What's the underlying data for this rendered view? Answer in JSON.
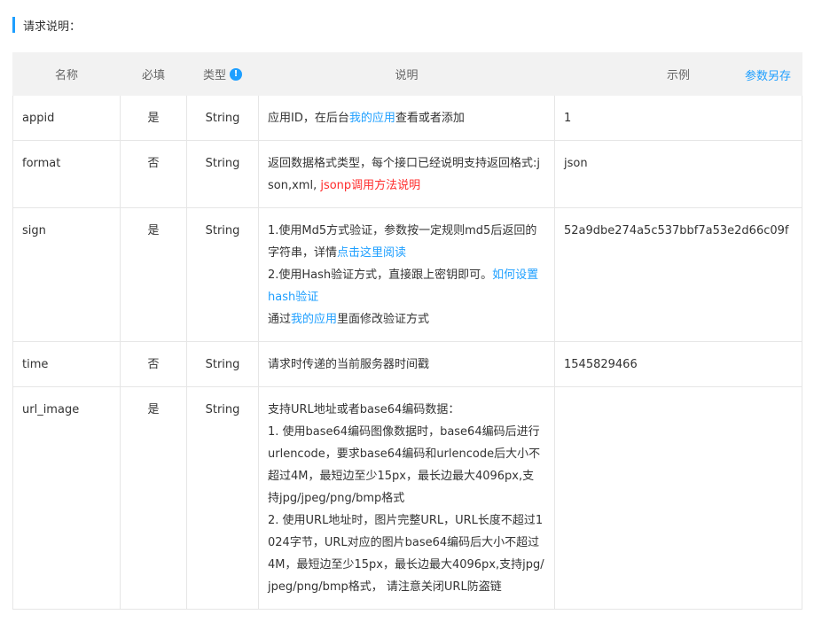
{
  "section": {
    "title": "请求说明："
  },
  "table": {
    "headers": {
      "name": "名称",
      "required": "必填",
      "type": "类型",
      "type_info_icon": "!",
      "desc": "说明",
      "example": "示例",
      "save_params": "参数另存"
    },
    "rows": [
      {
        "name": "appid",
        "required": "是",
        "type": "String",
        "desc": {
          "p1": "应用ID，在后台",
          "link1": "我的应用",
          "p2": "查看或者添加"
        },
        "example": "1"
      },
      {
        "name": "format",
        "required": "否",
        "type": "String",
        "desc": {
          "p1": "返回数据格式类型，每个接口已经说明支持返回格式:json,xml, ",
          "link1": "jsonp调用方法说明"
        },
        "example": "json"
      },
      {
        "name": "sign",
        "required": "是",
        "type": "String",
        "desc": {
          "p1": "1.使用Md5方式验证，参数按一定规则md5后返回的字符串，详情",
          "link1": "点击这里阅读",
          "p2": "2.使用Hash验证方式，直接跟上密钥即可。",
          "link2": "如何设置hash验证",
          "p3": "通过",
          "link3": "我的应用",
          "p4": "里面修改验证方式"
        },
        "example": "52a9dbe274a5c537bbf7a53e2d66c09f"
      },
      {
        "name": "time",
        "required": "否",
        "type": "String",
        "desc": {
          "p1": "请求时传递的当前服务器时间戳"
        },
        "example": "1545829466"
      },
      {
        "name": "url_image",
        "required": "是",
        "type": "String",
        "desc": {
          "l1": "支持URL地址或者base64编码数据：",
          "l2": "1. 使用base64编码图像数据时，base64编码后进行urlencode，要求base64编码和urlencode后大小不超过4M，最短边至少15px，最长边最大4096px,支持jpg/jpeg/png/bmp格式",
          "l3": "2. 使用URL地址时，图片完整URL，URL长度不超过1024字节，URL对应的图片base64编码后大小不超过4M，最短边至少15px，最长边最大4096px,支持jpg/jpeg/png/bmp格式， 请注意关闭URL防盗链"
        },
        "example": ""
      }
    ]
  },
  "colors": {
    "accent": "#1e9fff",
    "required_yes": "#e74c3c",
    "header_bg": "#f2f2f2",
    "border": "#e6e6e6"
  }
}
